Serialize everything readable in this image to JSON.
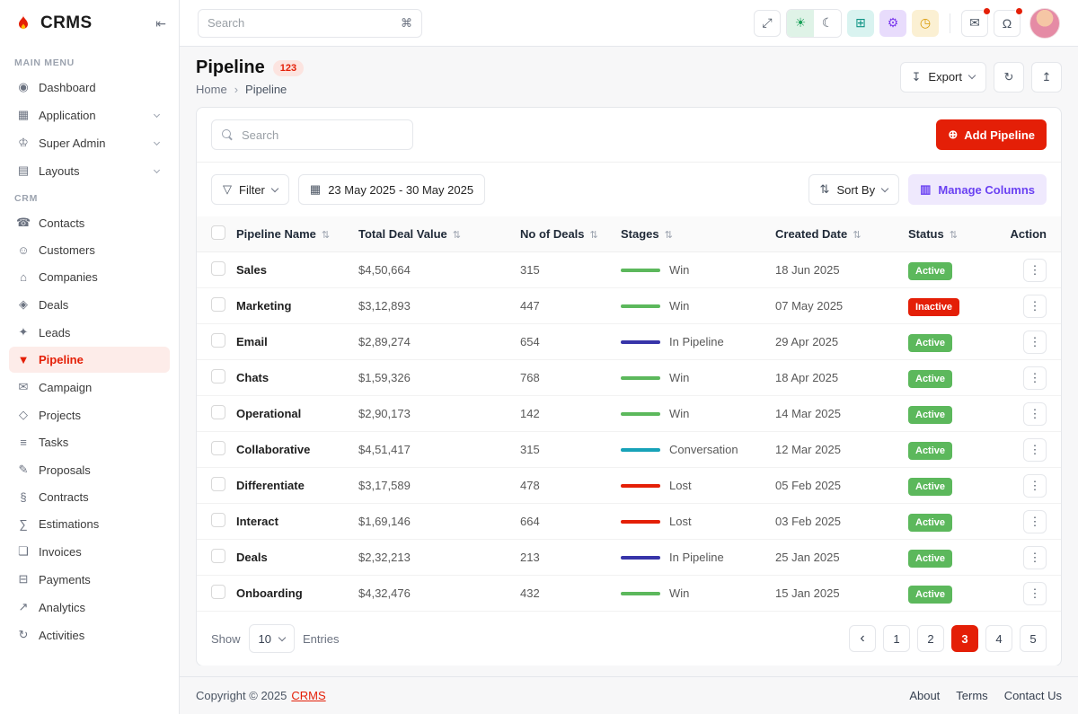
{
  "colors": {
    "primary": "#E41F07",
    "success": "#5CB85C",
    "purple": "#6A41F2",
    "purple-soft": "#EFE9FD",
    "teal": "#0E9384",
    "teal-soft": "#D9F3F0",
    "amber": "#D99A06",
    "amber-soft": "#FBF0D3",
    "green-soft": "#DFF3E7",
    "violet-soft": "#E8DCFC"
  },
  "icons": {
    "collapse": "⇤",
    "command": "⌘",
    "fullscreen": "⤢",
    "sun": "☀",
    "moon": "☾",
    "grid": "⊞",
    "gear": "⚙",
    "clock": "◷",
    "message": "✉",
    "bell": "Ω",
    "export": "↧",
    "refresh": "↻",
    "collapse_card": "↥",
    "plus": "⊕",
    "filter": "▽",
    "calendar": "▦",
    "sort": "⇅",
    "columns": "▥"
  },
  "app": {
    "name": "CRMS"
  },
  "sidebar": {
    "section1": {
      "label": "MAIN MENU",
      "items": [
        {
          "label": "Dashboard",
          "icon": "dashboard-icon",
          "glyph": "◉"
        },
        {
          "label": "Application",
          "icon": "application-icon",
          "glyph": "▦",
          "chevron": true
        },
        {
          "label": "Super Admin",
          "icon": "super-admin-icon",
          "glyph": "♔",
          "chevron": true
        },
        {
          "label": "Layouts",
          "icon": "layouts-icon",
          "glyph": "▤",
          "chevron": true
        }
      ]
    },
    "section2": {
      "label": "CRM",
      "items": [
        {
          "label": "Contacts",
          "icon": "contacts-icon",
          "glyph": "☎"
        },
        {
          "label": "Customers",
          "icon": "customers-icon",
          "glyph": "☺"
        },
        {
          "label": "Companies",
          "icon": "companies-icon",
          "glyph": "⌂"
        },
        {
          "label": "Deals",
          "icon": "deals-icon",
          "glyph": "◈"
        },
        {
          "label": "Leads",
          "icon": "leads-icon",
          "glyph": "✦"
        },
        {
          "label": "Pipeline",
          "icon": "pipeline-icon",
          "glyph": "▼",
          "active": true
        },
        {
          "label": "Campaign",
          "icon": "campaign-icon",
          "glyph": "✉"
        },
        {
          "label": "Projects",
          "icon": "projects-icon",
          "glyph": "◇"
        },
        {
          "label": "Tasks",
          "icon": "tasks-icon",
          "glyph": "≡"
        },
        {
          "label": "Proposals",
          "icon": "proposals-icon",
          "glyph": "✎"
        },
        {
          "label": "Contracts",
          "icon": "contracts-icon",
          "glyph": "§"
        },
        {
          "label": "Estimations",
          "icon": "estimations-icon",
          "glyph": "∑"
        },
        {
          "label": "Invoices",
          "icon": "invoices-icon",
          "glyph": "❏"
        },
        {
          "label": "Payments",
          "icon": "payments-icon",
          "glyph": "⊟"
        },
        {
          "label": "Analytics",
          "icon": "analytics-icon",
          "glyph": "↗"
        },
        {
          "label": "Activities",
          "icon": "activities-icon",
          "glyph": "↻"
        }
      ]
    }
  },
  "topbar": {
    "search_placeholder": "Search"
  },
  "page": {
    "title": "Pipeline",
    "count_badge": "123",
    "breadcrumb_home": "Home",
    "breadcrumb_current": "Pipeline",
    "export_label": "Export"
  },
  "toolbar": {
    "search_placeholder": "Search",
    "add_label": "Add Pipeline",
    "filter_label": "Filter",
    "date_range": "23 May 2025 - 30 May 2025",
    "sort_label": "Sort By",
    "manage_columns_label": "Manage Columns"
  },
  "table": {
    "columns": [
      {
        "label": "Pipeline Name",
        "sortable": true
      },
      {
        "label": "Total Deal Value",
        "sortable": true
      },
      {
        "label": "No of Deals",
        "sortable": true
      },
      {
        "label": "Stages",
        "sortable": true
      },
      {
        "label": "Created Date",
        "sortable": true
      },
      {
        "label": "Status",
        "sortable": true
      },
      {
        "label": "Action",
        "sortable": false
      }
    ],
    "rows": [
      {
        "name": "Sales",
        "value": "$4,50,664",
        "deals": "315",
        "stage": "Win",
        "stage_color": "#5CB85C",
        "date": "18 Jun 2025",
        "status": "Active",
        "status_class": "st-active"
      },
      {
        "name": "Marketing",
        "value": "$3,12,893",
        "deals": "447",
        "stage": "Win",
        "stage_color": "#5CB85C",
        "date": "07 May 2025",
        "status": "Inactive",
        "status_class": "st-inactive"
      },
      {
        "name": "Email",
        "value": "$2,89,274",
        "deals": "654",
        "stage": "In Pipeline",
        "stage_color": "#3734A9",
        "date": "29 Apr 2025",
        "status": "Active",
        "status_class": "st-active"
      },
      {
        "name": "Chats",
        "value": "$1,59,326",
        "deals": "768",
        "stage": "Win",
        "stage_color": "#5CB85C",
        "date": "18 Apr 2025",
        "status": "Active",
        "status_class": "st-active"
      },
      {
        "name": "Operational",
        "value": "$2,90,173",
        "deals": "142",
        "stage": "Win",
        "stage_color": "#5CB85C",
        "date": "14 Mar 2025",
        "status": "Active",
        "status_class": "st-active"
      },
      {
        "name": "Collaborative",
        "value": "$4,51,417",
        "deals": "315",
        "stage": "Conversation",
        "stage_color": "#17A2B8",
        "date": "12 Mar 2025",
        "status": "Active",
        "status_class": "st-active"
      },
      {
        "name": "Differentiate",
        "value": "$3,17,589",
        "deals": "478",
        "stage": "Lost",
        "stage_color": "#E41F07",
        "date": "05 Feb 2025",
        "status": "Active",
        "status_class": "st-active"
      },
      {
        "name": "Interact",
        "value": "$1,69,146",
        "deals": "664",
        "stage": "Lost",
        "stage_color": "#E41F07",
        "date": "03 Feb 2025",
        "status": "Active",
        "status_class": "st-active"
      },
      {
        "name": "Deals",
        "value": "$2,32,213",
        "deals": "213",
        "stage": "In Pipeline",
        "stage_color": "#3734A9",
        "date": "25 Jan 2025",
        "status": "Active",
        "status_class": "st-active"
      },
      {
        "name": "Onboarding",
        "value": "$4,32,476",
        "deals": "432",
        "stage": "Win",
        "stage_color": "#5CB85C",
        "date": "15 Jan 2025",
        "status": "Active",
        "status_class": "st-active"
      }
    ]
  },
  "pagination": {
    "show_label": "Show",
    "entries_value": "10",
    "entries_label": "Entries",
    "pages": [
      {
        "label": "1"
      },
      {
        "label": "2"
      },
      {
        "label": "3",
        "active": true
      },
      {
        "label": "4"
      },
      {
        "label": "5"
      }
    ]
  },
  "footer": {
    "copyright": "Copyright © 2025",
    "brand": "CRMS",
    "links": [
      {
        "label": "About"
      },
      {
        "label": "Terms"
      },
      {
        "label": "Contact Us"
      }
    ]
  }
}
